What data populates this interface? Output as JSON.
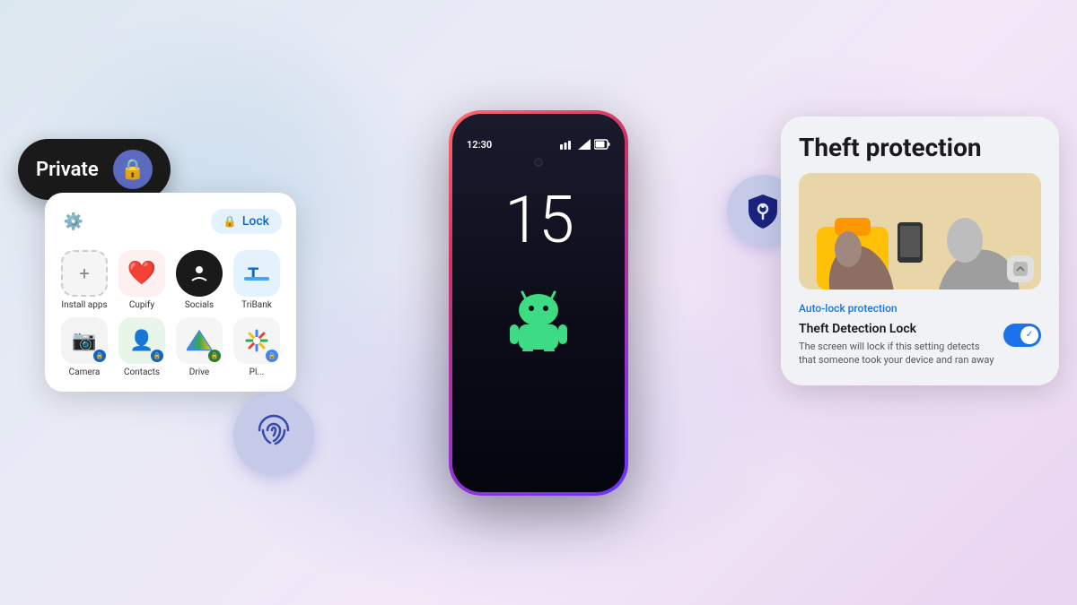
{
  "background": {
    "gradient": "linear-gradient(135deg, #dce8f0, #e8eaf6, #f3e8f8)"
  },
  "phone": {
    "time": "12:30",
    "clock_number": "15"
  },
  "private_pill": {
    "label": "Private",
    "icon": "🔒"
  },
  "app_drawer": {
    "lock_btn_label": "Lock",
    "apps": [
      {
        "name": "Install apps",
        "icon": "+",
        "type": "install"
      },
      {
        "name": "Cupify",
        "icon": "❤",
        "type": "cupify"
      },
      {
        "name": "Socials",
        "icon": "●",
        "type": "socials"
      },
      {
        "name": "TriBank",
        "icon": "T",
        "type": "tribank"
      },
      {
        "name": "Camera",
        "icon": "📷",
        "type": "camera"
      },
      {
        "name": "Contacts",
        "icon": "👤",
        "type": "contacts"
      },
      {
        "name": "Drive",
        "icon": "△",
        "type": "drive"
      },
      {
        "name": "Photos",
        "icon": "✳",
        "type": "photos"
      }
    ]
  },
  "theft_card": {
    "title": "Theft protection",
    "auto_lock_label": "Auto-lock protection",
    "detect_title": "Theft Detection Lock",
    "detect_desc": "The screen will lock if this setting detects that someone took your device and ran away",
    "toggle_state": "on"
  }
}
